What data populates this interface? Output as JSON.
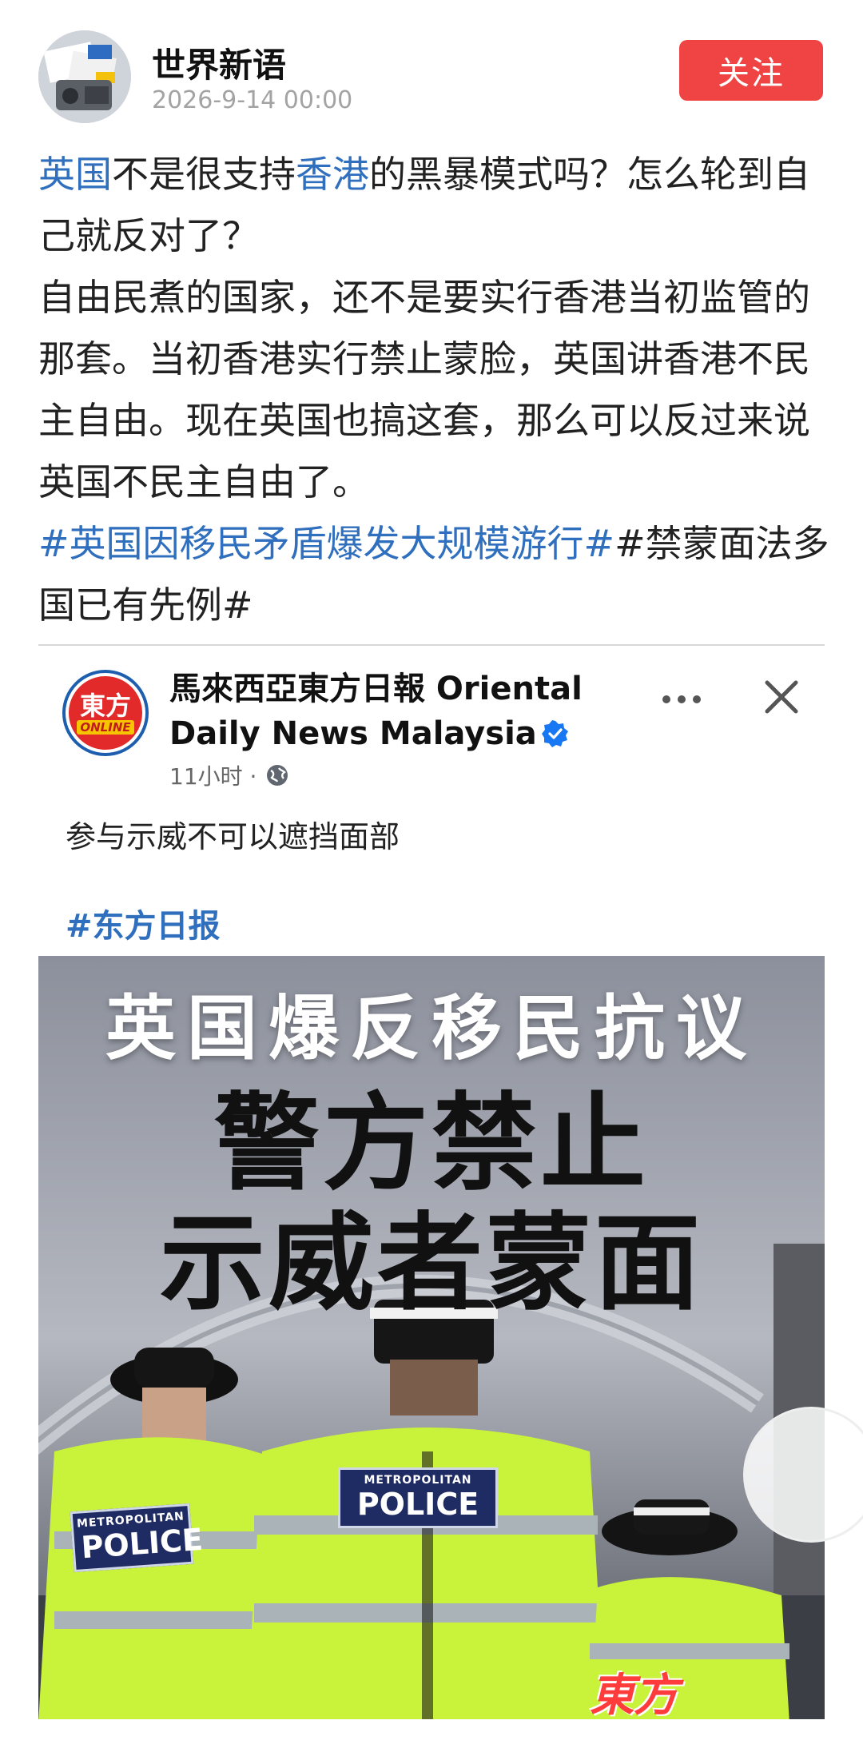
{
  "header": {
    "author_name": "世界新语",
    "post_time": "2026-9-14 00:00",
    "follow_label": "关注"
  },
  "post": {
    "line1_link1": "英国",
    "line1_mid": "不是很支持",
    "line1_link2": "香港",
    "line1_rest": "的黑暴模式吗？怎么轮到自己就反对了？",
    "para2": "自由民煮的国家，还不是要实行香港当初监管的那套。当初香港实行禁止蒙脸，英国讲香港不民主自由。现在英国也搞这套，那么可以反过来说英国不民主自由了。",
    "hashtag1": "#英国因移民矛盾爆发大规模游行#",
    "hashtag2": "#禁蒙面法多国已有先例#"
  },
  "card": {
    "logo_line1": "東方",
    "logo_line2": "ONLINE",
    "page_name": "馬來西亞東方日報 Oriental Daily News Malaysia",
    "time": "11小时 ·",
    "text": "参与示威不可以遮挡面部",
    "tag": "#东方日报",
    "headline_top": "英国爆反移民抗议",
    "headline_main_1": "警方禁止",
    "headline_main_2": "示威者蒙面",
    "badge_small_1": "METROPOLITAN",
    "badge_big_1": "POLICE",
    "badge_small_2": "METROPOLITAN",
    "badge_big_2": "POLICE",
    "watermark": "東方ONLINE"
  },
  "colors": {
    "link": "#2f6fbd",
    "follow_bg": "#f04444",
    "hi_vis": "#c9f23a",
    "police_blue": "#1f2b63"
  },
  "icons": [
    "avatar-image",
    "verified-icon",
    "globe-icon",
    "more-icon",
    "close-icon"
  ]
}
